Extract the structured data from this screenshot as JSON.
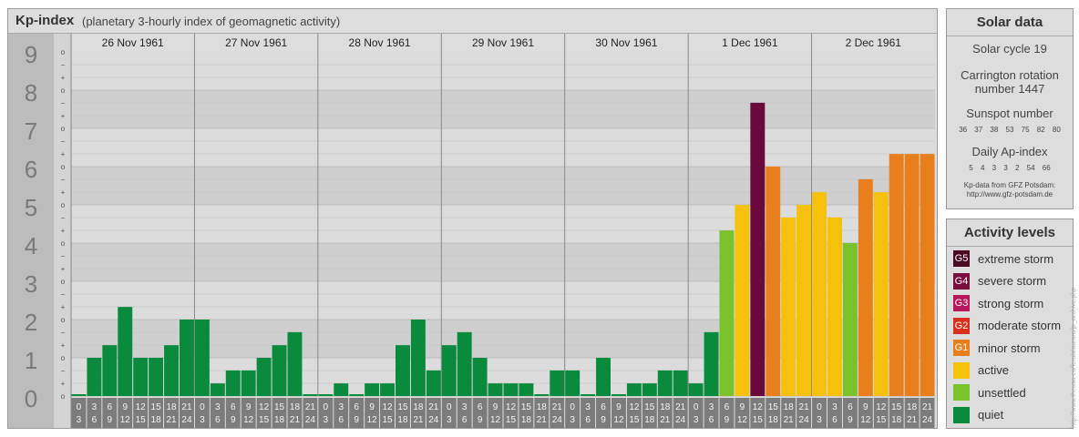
{
  "title": {
    "main": "Kp-index",
    "sub": "(planetary 3-hourly index of geomagnetic activity)"
  },
  "chart_data": {
    "type": "bar",
    "title": "Kp-index",
    "ylim": [
      0,
      9
    ],
    "y_ticks": [
      "0",
      "1",
      "2",
      "3",
      "4",
      "5",
      "6",
      "7",
      "8",
      "9"
    ],
    "y_subticks": [
      "−",
      "o",
      "+"
    ],
    "days": [
      "26 Nov 1961",
      "27 Nov 1961",
      "28 Nov 1961",
      "29 Nov 1961",
      "30 Nov 1961",
      "1 Dec 1961",
      "2 Dec 1961"
    ],
    "interval_starts": [
      "0",
      "3",
      "6",
      "9",
      "12",
      "15",
      "18",
      "21"
    ],
    "interval_ends": [
      "3",
      "6",
      "9",
      "12",
      "15",
      "18",
      "21",
      "24"
    ],
    "values": [
      0.0,
      1.0,
      1.33,
      2.33,
      1.0,
      1.0,
      1.33,
      2.0,
      2.0,
      0.33,
      0.67,
      0.67,
      1.0,
      1.33,
      1.67,
      0.0,
      0.0,
      0.33,
      0.0,
      0.33,
      0.33,
      1.33,
      2.0,
      0.67,
      1.33,
      1.67,
      1.0,
      0.33,
      0.33,
      0.33,
      0.0,
      0.67,
      0.67,
      0.0,
      1.0,
      0.0,
      0.33,
      0.33,
      0.67,
      0.67,
      0.33,
      1.67,
      4.33,
      5.0,
      7.67,
      6.0,
      4.67,
      5.0,
      5.33,
      4.67,
      4.0,
      5.67,
      5.33,
      6.33,
      6.33,
      6.33
    ],
    "levels": [
      {
        "max": 3.5,
        "color": "#0a8a3c"
      },
      {
        "max": 4.5,
        "color": "#7ac229"
      },
      {
        "max": 5.5,
        "color": "#f5c10a"
      },
      {
        "max": 6.5,
        "color": "#e87e1c"
      },
      {
        "max": 7.5,
        "color": "#d82f1e"
      },
      {
        "max": 9.0,
        "color": "#6a0a3c"
      }
    ]
  },
  "solar": {
    "header": "Solar data",
    "cycle": "Solar cycle 19",
    "carrington_1": "Carrington rotation",
    "carrington_2": "number 1447",
    "sunspot_label": "Sunspot number",
    "sunspot_values": "36 37 38 53 75 82 80",
    "ap_label": "Daily Ap-index",
    "ap_values": "5 4 3 3 2 54 66",
    "source_1": "Kp-data from GFZ Potsdam:",
    "source_2": "http://www.gfz-potsdam.de"
  },
  "legend": {
    "header": "Activity levels",
    "items": [
      {
        "code": "G5",
        "label": "extreme storm",
        "color": "#4a0a24"
      },
      {
        "code": "G4",
        "label": "severe storm",
        "color": "#7a0e3c"
      },
      {
        "code": "G3",
        "label": "strong storm",
        "color": "#b8165a"
      },
      {
        "code": "G2",
        "label": "moderate storm",
        "color": "#d82f1e"
      },
      {
        "code": "G1",
        "label": "minor storm",
        "color": "#e87e1c"
      },
      {
        "code": "",
        "label": "active",
        "color": "#f5c10a"
      },
      {
        "code": "",
        "label": "unsettled",
        "color": "#7ac229"
      },
      {
        "code": "",
        "label": "quiet",
        "color": "#0a8a3c"
      }
    ]
  },
  "watermark": "http://www.theusa-eu/ferals/aurora/jp_archive.php"
}
